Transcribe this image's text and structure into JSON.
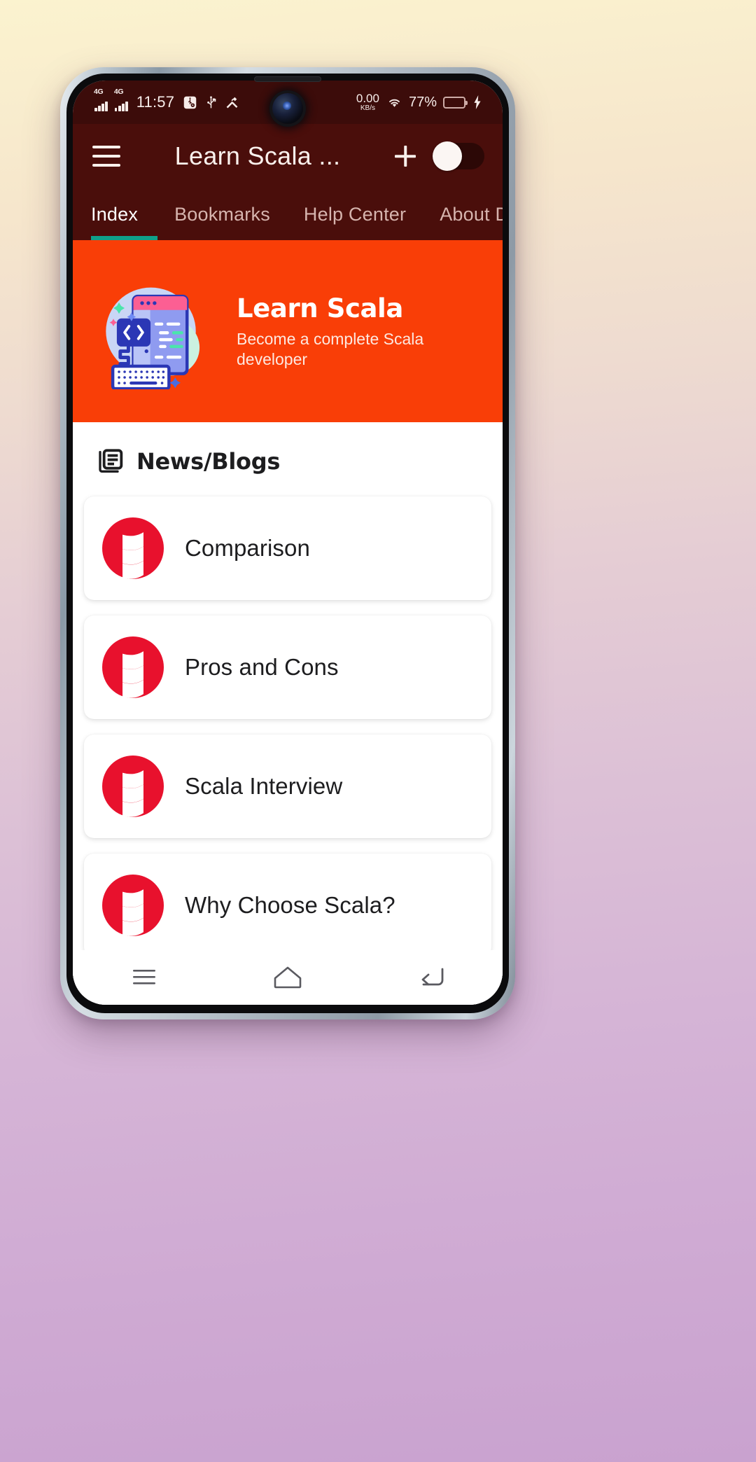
{
  "status_bar": {
    "network_type_1": "4G",
    "network_type_2": "4G",
    "time": "11:57",
    "icons": [
      "usb-debug-icon",
      "usb-icon",
      "developer-tools-icon",
      "wifi-icon"
    ],
    "net_speed_value": "0.00",
    "net_speed_unit": "KB/s",
    "battery_percent": "77%",
    "battery_level": 70,
    "charging": true,
    "background_color": "#3c0c0a"
  },
  "app_bar": {
    "title": "Learn Scala ...",
    "menu_icon": "hamburger-menu-icon",
    "add_icon": "plus-icon",
    "theme_toggle_state": "off",
    "background_color": "#4a0e0b"
  },
  "tabs": {
    "items": [
      {
        "label": "Index",
        "active": true
      },
      {
        "label": "Bookmarks",
        "active": false
      },
      {
        "label": "Help Center",
        "active": false
      },
      {
        "label": "About De",
        "active": false
      }
    ],
    "indicator_color": "#10a08a"
  },
  "hero": {
    "title": "Learn Scala",
    "subtitle": "Become a complete Scala developer",
    "background_color": "#f93e07",
    "illustration": "coding-laptop-illustration"
  },
  "section": {
    "title": "News/Blogs",
    "icon": "article-icon"
  },
  "cards": [
    {
      "label": "Comparison",
      "icon": "scala-logo-icon"
    },
    {
      "label": "Pros and Cons",
      "icon": "scala-logo-icon"
    },
    {
      "label": "Scala Interview",
      "icon": "scala-logo-icon"
    },
    {
      "label": "Why Choose Scala?",
      "icon": "scala-logo-icon"
    }
  ],
  "nav_bar": {
    "recents": "recents-icon",
    "home": "home-icon",
    "back": "back-icon"
  },
  "colors": {
    "scala_red": "#e8112d",
    "app_bar": "#4a0e0b",
    "status_bar": "#3c0c0a",
    "hero_orange": "#f93e07",
    "tab_indicator": "#10a08a"
  }
}
